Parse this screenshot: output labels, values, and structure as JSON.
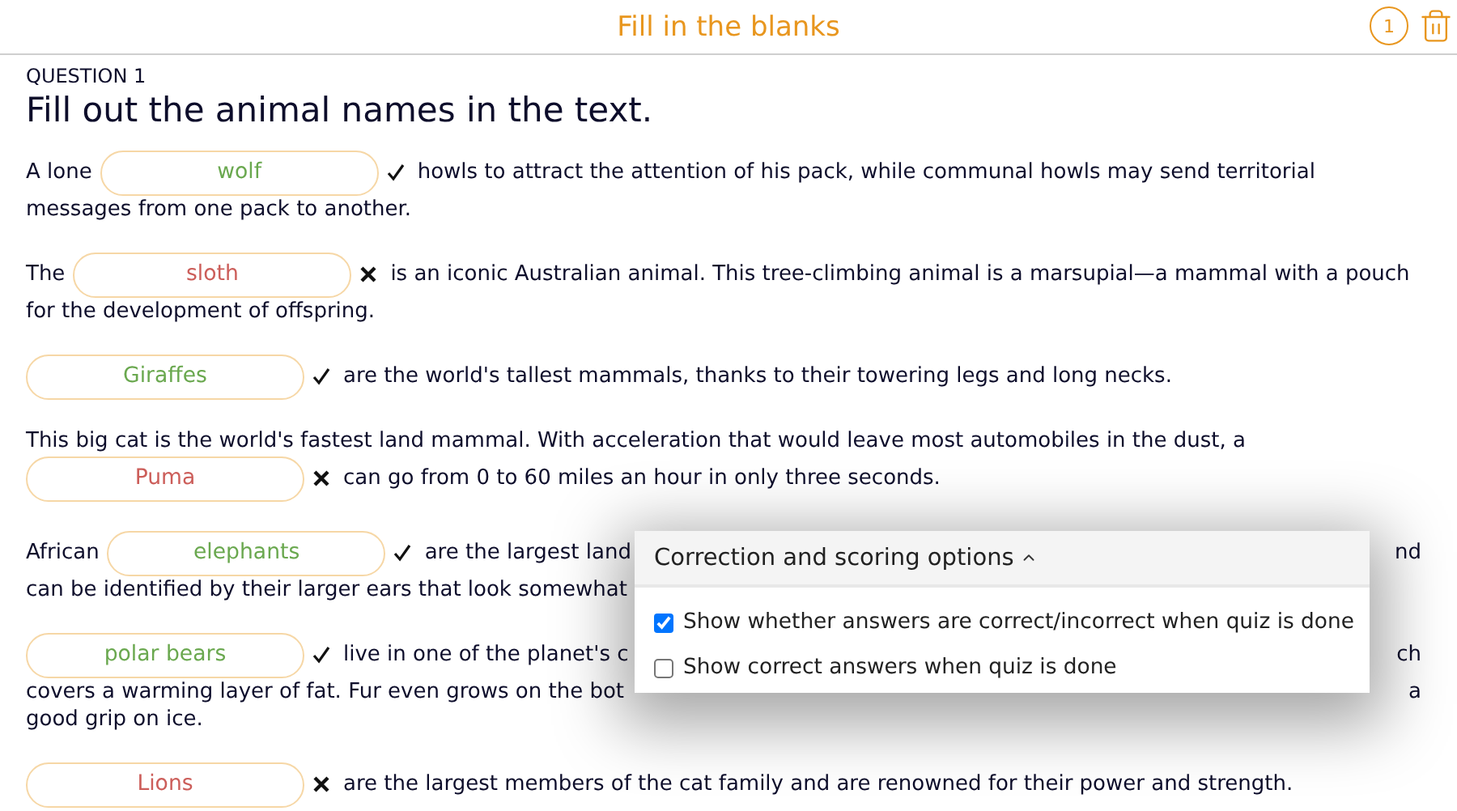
{
  "header": {
    "title": "Fill in the blanks",
    "badge": "1"
  },
  "question": {
    "label": "QUESTION 1",
    "title": "Fill out the animal names in the text."
  },
  "paragraphs": [
    {
      "lines": [
        [
          {
            "kind": "text",
            "text": "A lone"
          },
          {
            "kind": "blank",
            "answer": "wolf",
            "correct": true
          },
          {
            "kind": "text",
            "text": "howls to attract the attention of his pack, while communal howls may send territorial"
          }
        ],
        [
          {
            "kind": "text",
            "text": "messages from one pack to another."
          }
        ]
      ]
    },
    {
      "lines": [
        [
          {
            "kind": "text",
            "text": "The"
          },
          {
            "kind": "blank",
            "answer": "sloth",
            "correct": false
          },
          {
            "kind": "text",
            "text": "is an iconic Australian animal. This tree-climbing animal is a marsupial—a mammal with a pouch"
          }
        ],
        [
          {
            "kind": "text",
            "text": "for the development of offspring."
          }
        ]
      ]
    },
    {
      "lines": [
        [
          {
            "kind": "blank",
            "answer": "Giraffes",
            "correct": true
          },
          {
            "kind": "text",
            "text": "are the world's tallest mammals, thanks to their towering legs and long necks."
          }
        ]
      ]
    },
    {
      "lines": [
        [
          {
            "kind": "text",
            "text": "This big cat is the world's fastest land mammal. With acceleration that would leave most automobiles in the dust, a"
          }
        ],
        [
          {
            "kind": "blank",
            "answer": "Puma",
            "correct": false
          },
          {
            "kind": "text",
            "text": "can go from 0 to 60 miles an hour in only three seconds."
          }
        ]
      ]
    },
    {
      "lines": [
        [
          {
            "kind": "text",
            "text": "African"
          },
          {
            "kind": "blank",
            "answer": "elephants",
            "correct": true
          },
          {
            "kind": "text",
            "text": "are the largest land"
          },
          {
            "kind": "right",
            "text": "nd"
          }
        ],
        [
          {
            "kind": "text",
            "text": "can be identified by their larger ears that look somewhat"
          }
        ]
      ]
    },
    {
      "lines": [
        [
          {
            "kind": "blank",
            "answer": "polar bears",
            "correct": true
          },
          {
            "kind": "text",
            "text": "live in one of the planet's c"
          },
          {
            "kind": "right",
            "text": "ch"
          }
        ],
        [
          {
            "kind": "text",
            "text": "covers a warming layer of fat. Fur even grows on the bot"
          },
          {
            "kind": "right",
            "text": "a"
          }
        ],
        [
          {
            "kind": "text",
            "text": "good grip on ice."
          }
        ]
      ]
    },
    {
      "lines": [
        [
          {
            "kind": "blank",
            "answer": "Lions",
            "correct": false
          },
          {
            "kind": "text",
            "text": "are the largest members of the cat family and are renowned for their power and strength."
          }
        ]
      ]
    }
  ],
  "options_panel": {
    "title": "Correction and scoring options",
    "expanded": true,
    "options": [
      {
        "label": "Show whether answers are correct/incorrect when quiz is done",
        "checked": true
      },
      {
        "label": "Show correct answers when quiz is done",
        "checked": false
      }
    ]
  }
}
